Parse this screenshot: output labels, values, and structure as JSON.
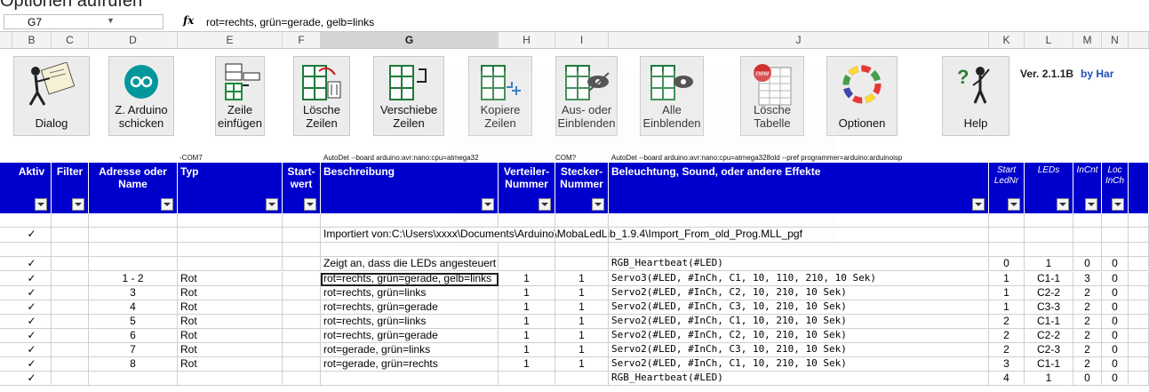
{
  "caption": "Optionen aufrufen",
  "formula_bar": {
    "cell_ref": "G7",
    "fx": "fx",
    "formula": "rot=rechts, grün=gerade, gelb=links"
  },
  "columns": [
    "B",
    "C",
    "D",
    "E",
    "F",
    "G",
    "H",
    "I",
    "J",
    "K",
    "L",
    "M",
    "N"
  ],
  "selected_column": "G",
  "toolbar": {
    "buttons": [
      {
        "label": "Dialog",
        "icon": "dialog-figure-icon"
      },
      {
        "label": "Z. Arduino schicken",
        "icon": "arduino-icon"
      },
      {
        "label": "Zeile einfügen",
        "icon": "insert-row-icon"
      },
      {
        "label": "Lösche Zeilen",
        "icon": "delete-rows-icon"
      },
      {
        "label": "Verschiebe Zeilen",
        "icon": "move-rows-icon"
      },
      {
        "label": "Kopiere Zeilen",
        "icon": "copy-rows-icon"
      },
      {
        "label": "Aus- oder Einblenden",
        "icon": "hide-rows-icon"
      },
      {
        "label": "Alle Einblenden",
        "icon": "show-all-icon"
      },
      {
        "label": "Lösche Tabelle",
        "icon": "delete-table-icon"
      },
      {
        "label": "Optionen",
        "icon": "options-ring-icon"
      },
      {
        "label": "Help",
        "icon": "help-figure-icon"
      }
    ],
    "version": "Ver. 2.1.1B",
    "by": "by Har"
  },
  "info_lines": {
    "com7": "-COM7",
    "autodet1": "AutoDet --board arduino:avr:nano:cpu=atmega32",
    "com": "COM?",
    "autodet2": "AutoDet --board arduino:avr:nano:cpu=atmega328old --pref programmer=arduino:arduinoisp"
  },
  "headers": {
    "aktiv": "Aktiv",
    "filter": "Filter",
    "adresse": "Adresse oder Name",
    "typ": "Typ",
    "startwert": "Start- wert",
    "beschreibung": "Beschreibung",
    "verteiler": "Verteiler- Nummer",
    "stecker": "Stecker- Nummer",
    "beleuchtung": "Beleuchtung, Sound, oder andere Effekte",
    "start_led": "Start LedNr",
    "leds": "LEDs",
    "incnt": "InCnt",
    "loc": "Loc InCh"
  },
  "rows": [
    {
      "check": "",
      "addr": "",
      "typ": "",
      "desc": "",
      "vert": "",
      "steck": "",
      "effect": "",
      "start": "",
      "leds": "",
      "incnt": "",
      "loc": ""
    },
    {
      "check": "✓",
      "addr": "",
      "typ": "",
      "desc": "Importiert von:C:\\Users\\xxxx\\Documents\\Arduino\\MobaLedLib_1.9.4\\Import_From_old_Prog.MLL_pgf",
      "vert": "",
      "steck": "",
      "effect": "",
      "start": "",
      "leds": "",
      "incnt": "",
      "loc": ""
    },
    {
      "check": "",
      "addr": "",
      "typ": "",
      "desc": "",
      "vert": "",
      "steck": "",
      "effect": "",
      "start": "",
      "leds": "",
      "incnt": "",
      "loc": ""
    },
    {
      "check": "✓",
      "addr": "",
      "typ": "",
      "desc": "Zeigt an, dass die LEDs angesteuert werden",
      "vert": "",
      "steck": "",
      "effect": "RGB_Heartbeat(#LED)",
      "start": "0",
      "leds": "1",
      "incnt": "0",
      "loc": "0"
    },
    {
      "check": "✓",
      "addr": "1 - 2",
      "typ": "Rot",
      "desc": "rot=rechts, grün=gerade, gelb=links",
      "vert": "1",
      "steck": "1",
      "effect": "Servo3(#LED, #InCh, C1, 10, 110, 210, 10 Sek)",
      "start": "1",
      "leds": "C1-1",
      "incnt": "3",
      "loc": "0",
      "yellow": true
    },
    {
      "check": "✓",
      "addr": "3",
      "typ": "Rot",
      "desc": "rot=rechts, grün=links",
      "vert": "1",
      "steck": "1",
      "effect": "Servo2(#LED, #InCh, C2, 10, 210, 10 Sek)",
      "start": "1",
      "leds": "C2-2",
      "incnt": "2",
      "loc": "0"
    },
    {
      "check": "✓",
      "addr": "4",
      "typ": "Rot",
      "desc": "rot=rechts, grün=gerade",
      "vert": "1",
      "steck": "1",
      "effect": "Servo2(#LED, #InCh, C3, 10, 210, 10 Sek)",
      "start": "1",
      "leds": "C3-3",
      "incnt": "2",
      "loc": "0"
    },
    {
      "check": "✓",
      "addr": "5",
      "typ": "Rot",
      "desc": "rot=rechts, grün=links",
      "vert": "1",
      "steck": "1",
      "effect": "Servo2(#LED, #InCh, C1, 10, 210, 10 Sek)",
      "start": "2",
      "leds": "C1-1",
      "incnt": "2",
      "loc": "0"
    },
    {
      "check": "✓",
      "addr": "6",
      "typ": "Rot",
      "desc": "rot=rechts, grün=gerade",
      "vert": "1",
      "steck": "1",
      "effect": "Servo2(#LED, #InCh, C2, 10, 210, 10 Sek)",
      "start": "2",
      "leds": "C2-2",
      "incnt": "2",
      "loc": "0"
    },
    {
      "check": "✓",
      "addr": "7",
      "typ": "Rot",
      "desc": "rot=gerade, grün=links",
      "vert": "1",
      "steck": "1",
      "effect": "Servo2(#LED, #InCh, C3, 10, 210, 10 Sek)",
      "start": "2",
      "leds": "C2-3",
      "incnt": "2",
      "loc": "0"
    },
    {
      "check": "✓",
      "addr": "8",
      "typ": "Rot",
      "desc": "rot=gerade, grün=rechts",
      "vert": "1",
      "steck": "1",
      "effect": "Servo2(#LED, #InCh, C1, 10, 210, 10 Sek)",
      "start": "3",
      "leds": "C1-1",
      "incnt": "2",
      "loc": "0"
    },
    {
      "check": "✓",
      "addr": "",
      "typ": "",
      "desc": "",
      "vert": "",
      "steck": "",
      "effect": "RGB_Heartbeat(#LED)",
      "start": "4",
      "leds": "1",
      "incnt": "0",
      "loc": "0"
    }
  ],
  "colors": {
    "header_bg": "#0000cc",
    "header_text": "#ffffff",
    "led_red": "#f28b82",
    "led_green": "#22c55e",
    "led_yellow": "#ffff66",
    "version_by": "#1f4fb8"
  }
}
